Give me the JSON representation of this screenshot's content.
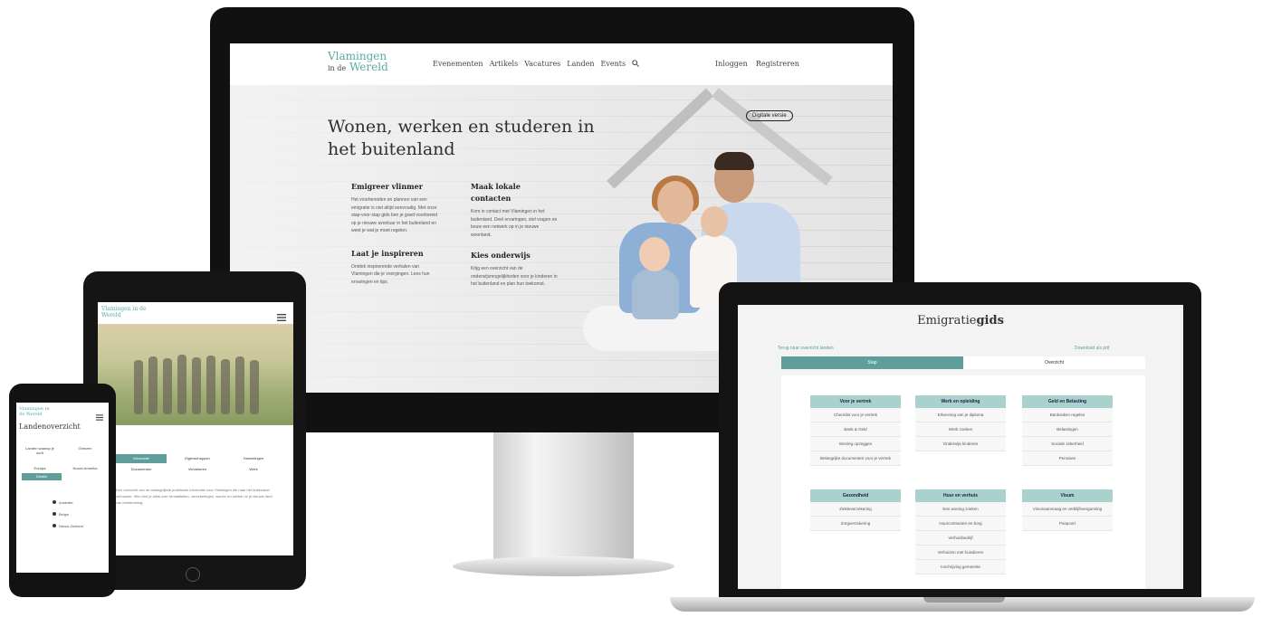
{
  "desktop": {
    "logo_top": "Vlamingen",
    "logo_bottom_small": "in de",
    "logo_bottom": "Wereld",
    "nav": [
      "Evenementen",
      "Artikels",
      "Vacatures",
      "Landen",
      "Events"
    ],
    "nav_right": [
      "Inloggen",
      "Registreren"
    ],
    "hero_title": "Wonen, werken en studeren in het buitenland",
    "outline_button": "Digitale versie",
    "col1_h1": "Emigreer vlinmer",
    "col1_t1": "Het voorbereiden en plannen van een emigratie is niet altijd eenvoudig. Met onze stap-voor-stap gids ben je goed voorbereid op je nieuwe avontuur in het buitenland en weet je wat je moet regelen.",
    "col1_h2": "Laat je inspireren",
    "col1_t2": "Ontdek inspirerende verhalen van Vlamingen die je voorgingen. Lees hun ervaringen en tips.",
    "col2_h1": "Maak lokale contacten",
    "col2_t1": "Kom in contact met Vlamingen in het buitenland. Deel ervaringen, stel vragen en bouw een netwerk op in je nieuwe woonland.",
    "col2_h2": "Kies onderwijs",
    "col2_t2": "Krijg een overzicht van de onderwijsmogelijkheden voor je kinderen in het buitenland en plan hun toekomst."
  },
  "tablet": {
    "logo": "Vlamingen in de Wereld",
    "tabs_row1": [
      "Informatie",
      "Eigenschappen",
      "Handelingen"
    ],
    "tabs_row2": [
      "Documenten",
      "Verzekeren",
      "Werk"
    ],
    "body_text": "Een overzicht van de belangrijkste praktische informatie voor Vlamingen die naar het buitenland verhuizen. Hier vind je alles over formaliteiten, verzekeringen, wonen en werken in je nieuwe land van bestemming."
  },
  "phone": {
    "logo": "Vlamingen in de Wereld",
    "title": "Landenoverzicht",
    "row1_left": "Landen waarop je surft",
    "row1_right": "Gelezen",
    "row2_left": "Europa",
    "row2_right": "Noord-Amerika",
    "button": "Details",
    "list": [
      "Australie",
      "Belgie",
      "Nieuw-Zeeland"
    ]
  },
  "laptop": {
    "title_plain": "Emigratie",
    "title_bold": "gids",
    "link_left": "Terug naar overzicht landen",
    "link_right": "Download als pdf",
    "tabs": [
      "Stap",
      "Overzicht"
    ],
    "cards": [
      {
        "header": "Voor je vertrek",
        "items": [
          "Checklist voor je vertrek",
          "Bank & Geld",
          "Woning opzeggen",
          "Belangrijke documenten voor je vertrek"
        ]
      },
      {
        "header": "Werk en opleiding",
        "items": [
          "Erkenning van je diploma",
          "Werk zoeken",
          "Onderwijs kinderen"
        ]
      },
      {
        "header": "Geld en Belasting",
        "items": [
          "Bankzaken regelen",
          "Belastingen",
          "Sociale zekerheid",
          "Pensioen"
        ]
      },
      {
        "header": "Gezondheid",
        "items": [
          "Ziekteverzekering",
          "Zorgverzekering"
        ]
      },
      {
        "header": "Huur en verhuis",
        "items": [
          "Een woning zoeken",
          "Huurcontracten en borg",
          "Verhuisbedrijf",
          "Verhuizen met huisdieren",
          "Inschrijving gemeente"
        ]
      },
      {
        "header": "Visum",
        "items": [
          "Visumaanvraag en verblijfsvergunning",
          "Paspoort"
        ]
      }
    ]
  }
}
